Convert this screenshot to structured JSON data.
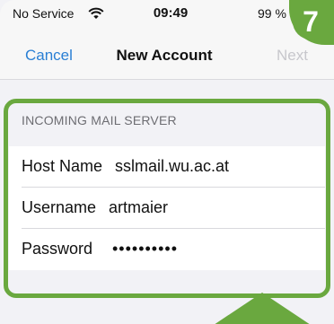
{
  "status_bar": {
    "carrier": "No Service",
    "time": "09:49",
    "battery": "99 %"
  },
  "nav": {
    "cancel_label": "Cancel",
    "title": "New Account",
    "next_label": "Next"
  },
  "step_badge": "7",
  "incoming": {
    "header": "INCOMING MAIL SERVER",
    "fields": [
      {
        "label": "Host Name",
        "value": "sslmail.wu.ac.at"
      },
      {
        "label": "Username",
        "value": "artmaier"
      },
      {
        "label": "Password",
        "value": "••••••••••"
      }
    ]
  },
  "colors": {
    "accent_green": "#6aa83f",
    "link_blue": "#2a7fd4",
    "disabled_gray": "#c7c7cc"
  }
}
